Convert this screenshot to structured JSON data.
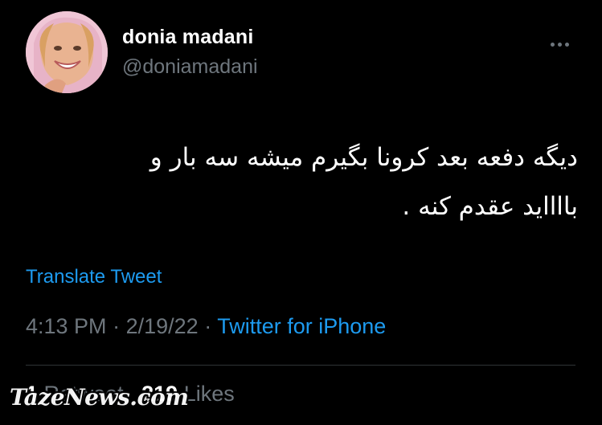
{
  "author": {
    "display_name": "donia madani",
    "handle": "@doniamadani"
  },
  "tweet": {
    "text_line1": "دیگه دفعه بعد کرونا بگیرم میشه سه بار و",
    "text_line2": "بااااید عقدم کنه ."
  },
  "actions": {
    "translate_label": "Translate Tweet"
  },
  "meta": {
    "time": "4:13 PM",
    "separator": "·",
    "date": "2/19/22",
    "source": "Twitter for iPhone"
  },
  "stats": {
    "retweets_count": "1",
    "retweets_label": "Retweet",
    "likes_count": "219",
    "likes_label": "Likes"
  },
  "watermark": {
    "text": "TazeNews.com"
  },
  "colors": {
    "background": "#000000",
    "accent": "#1d9bf0",
    "muted": "#6e767d"
  },
  "icons": {
    "more": "more-dots-icon"
  }
}
